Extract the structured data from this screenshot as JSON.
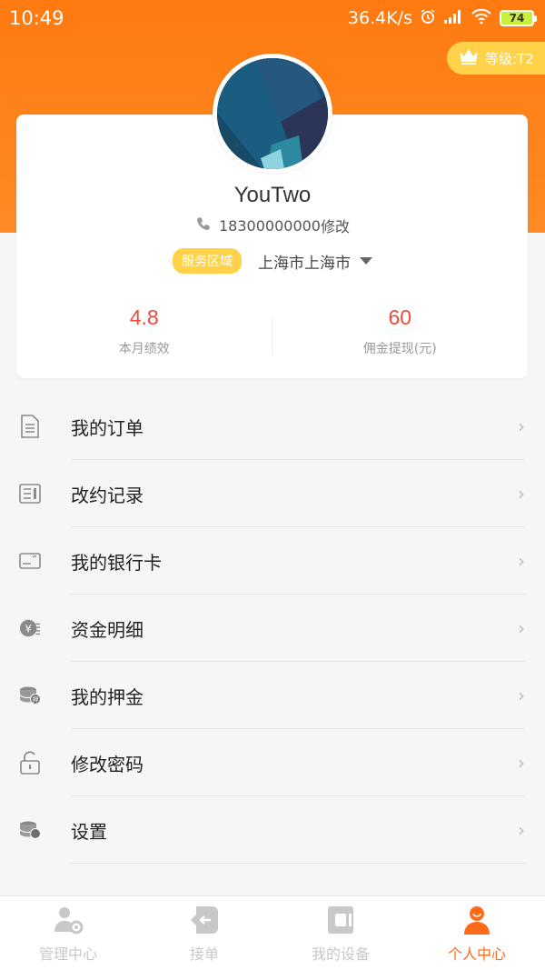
{
  "status_bar": {
    "time": "10:49",
    "speed": "36.4K/s",
    "battery": "74"
  },
  "level": {
    "label": "等级:T2"
  },
  "profile": {
    "username": "YouTwo",
    "phone": "18300000000",
    "edit_label": "修改"
  },
  "service_area": {
    "tag": "服务区域",
    "city": "上海市上海市"
  },
  "stats": [
    {
      "value": "4.8",
      "label": "本月绩效"
    },
    {
      "value": "60",
      "label": "佣金提现(元)"
    }
  ],
  "menu": [
    {
      "label": "我的订单",
      "icon": "document-icon"
    },
    {
      "label": "改约记录",
      "icon": "record-icon"
    },
    {
      "label": "我的银行卡",
      "icon": "bank-card-icon"
    },
    {
      "label": "资金明细",
      "icon": "fund-detail-icon"
    },
    {
      "label": "我的押金",
      "icon": "deposit-icon"
    },
    {
      "label": "修改密码",
      "icon": "lock-icon"
    },
    {
      "label": "设置",
      "icon": "settings-icon"
    }
  ],
  "tabs": [
    {
      "label": "管理中心",
      "icon": "manage-center-icon",
      "active": false
    },
    {
      "label": "接单",
      "icon": "accept-order-icon",
      "active": false
    },
    {
      "label": "我的设备",
      "icon": "device-icon",
      "active": false
    },
    {
      "label": "个人中心",
      "icon": "personal-center-icon",
      "active": true
    }
  ],
  "colors": {
    "accent": "#ff7a10",
    "stat_value": "#ee4b3a",
    "tag": "#ffd24a",
    "active_tab": "#ff6a1a"
  }
}
